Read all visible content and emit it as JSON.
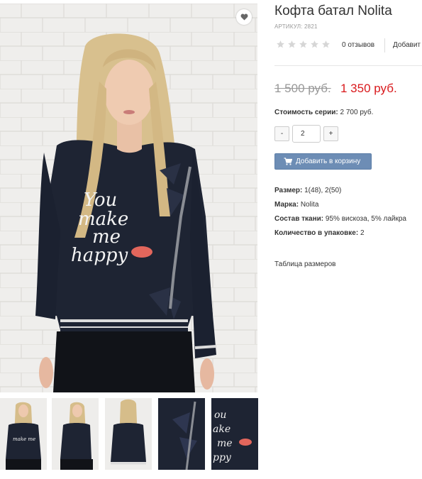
{
  "product": {
    "title": "Кофта батал Nolita",
    "sku_label": "АРТИКУЛ:",
    "sku_value": "2821",
    "rating": 0,
    "rating_max": 5,
    "reviews_label": "0 отзывов",
    "add_review_label": "Добавит"
  },
  "price": {
    "old": "1 500 руб.",
    "new": "1 350 руб."
  },
  "series": {
    "label": "Стоимость серии:",
    "value": "2 700 руб."
  },
  "quantity": {
    "minus": "-",
    "value": "2",
    "plus": "+"
  },
  "cart": {
    "button_label": "Добавить в корзину",
    "icon": "shopping-cart-icon"
  },
  "attributes": [
    {
      "label": "Размер:",
      "value": "1(48), 2(50)"
    },
    {
      "label": "Марка:",
      "value": "Nolita"
    },
    {
      "label": "Состав ткани:",
      "value": "95% вискоза, 5% лайкра"
    },
    {
      "label": "Количество в упаковке:",
      "value": "2"
    }
  ],
  "size_table_link": "Таблица размеров",
  "gallery": {
    "thumbnail_count": 5,
    "favorite_icon": "heart-icon",
    "print_text_lines": [
      "You",
      "make",
      "me",
      "happy"
    ]
  },
  "colors": {
    "new_price": "#d9191c",
    "cart_button": "#6d8db5",
    "garment": "#1e2433"
  }
}
